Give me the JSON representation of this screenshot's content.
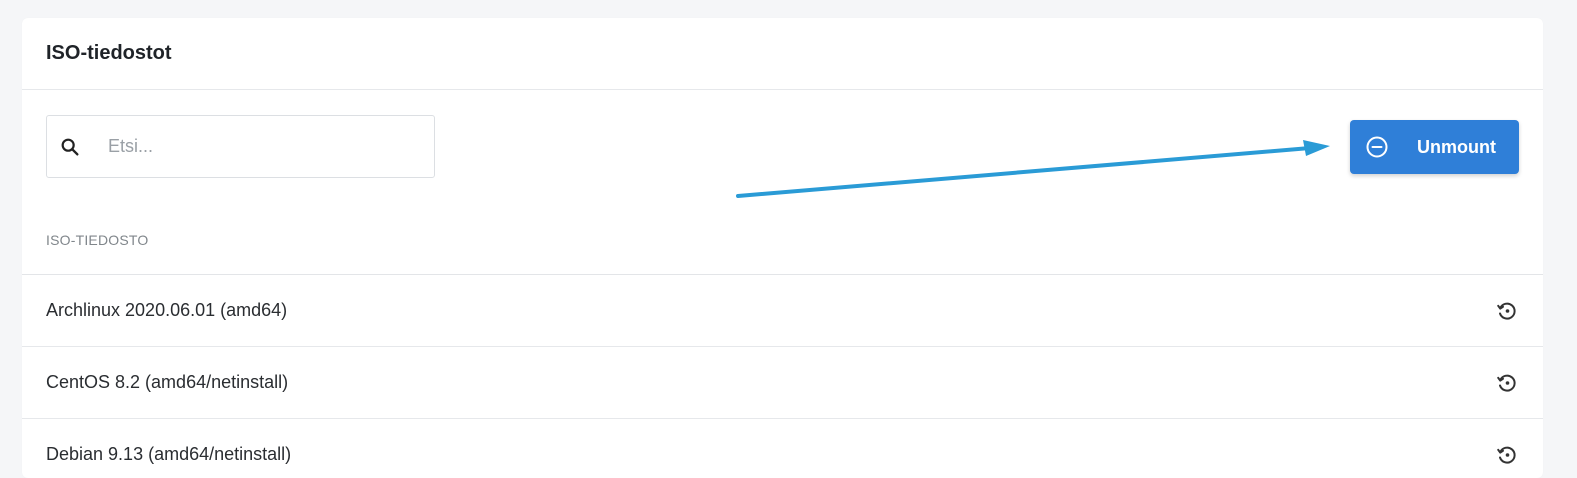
{
  "card": {
    "title": "ISO-tiedostot"
  },
  "search": {
    "placeholder": "Etsi...",
    "icon": "search-icon"
  },
  "toolbar": {
    "unmount_label": "Unmount",
    "unmount_icon": "minus-circle-icon"
  },
  "table": {
    "column_header": "ISO-TIEDOSTO",
    "rows": [
      {
        "label": "Archlinux 2020.06.01 (amd64)",
        "icon": "restore-icon"
      },
      {
        "label": "CentOS 8.2 (amd64/netinstall)",
        "icon": "restore-icon"
      },
      {
        "label": "Debian 9.13 (amd64/netinstall)",
        "icon": "restore-icon"
      }
    ]
  },
  "colors": {
    "accent": "#2f7fd8",
    "annotation_arrow": "#2a9bd6",
    "background": "#f5f6f8"
  }
}
